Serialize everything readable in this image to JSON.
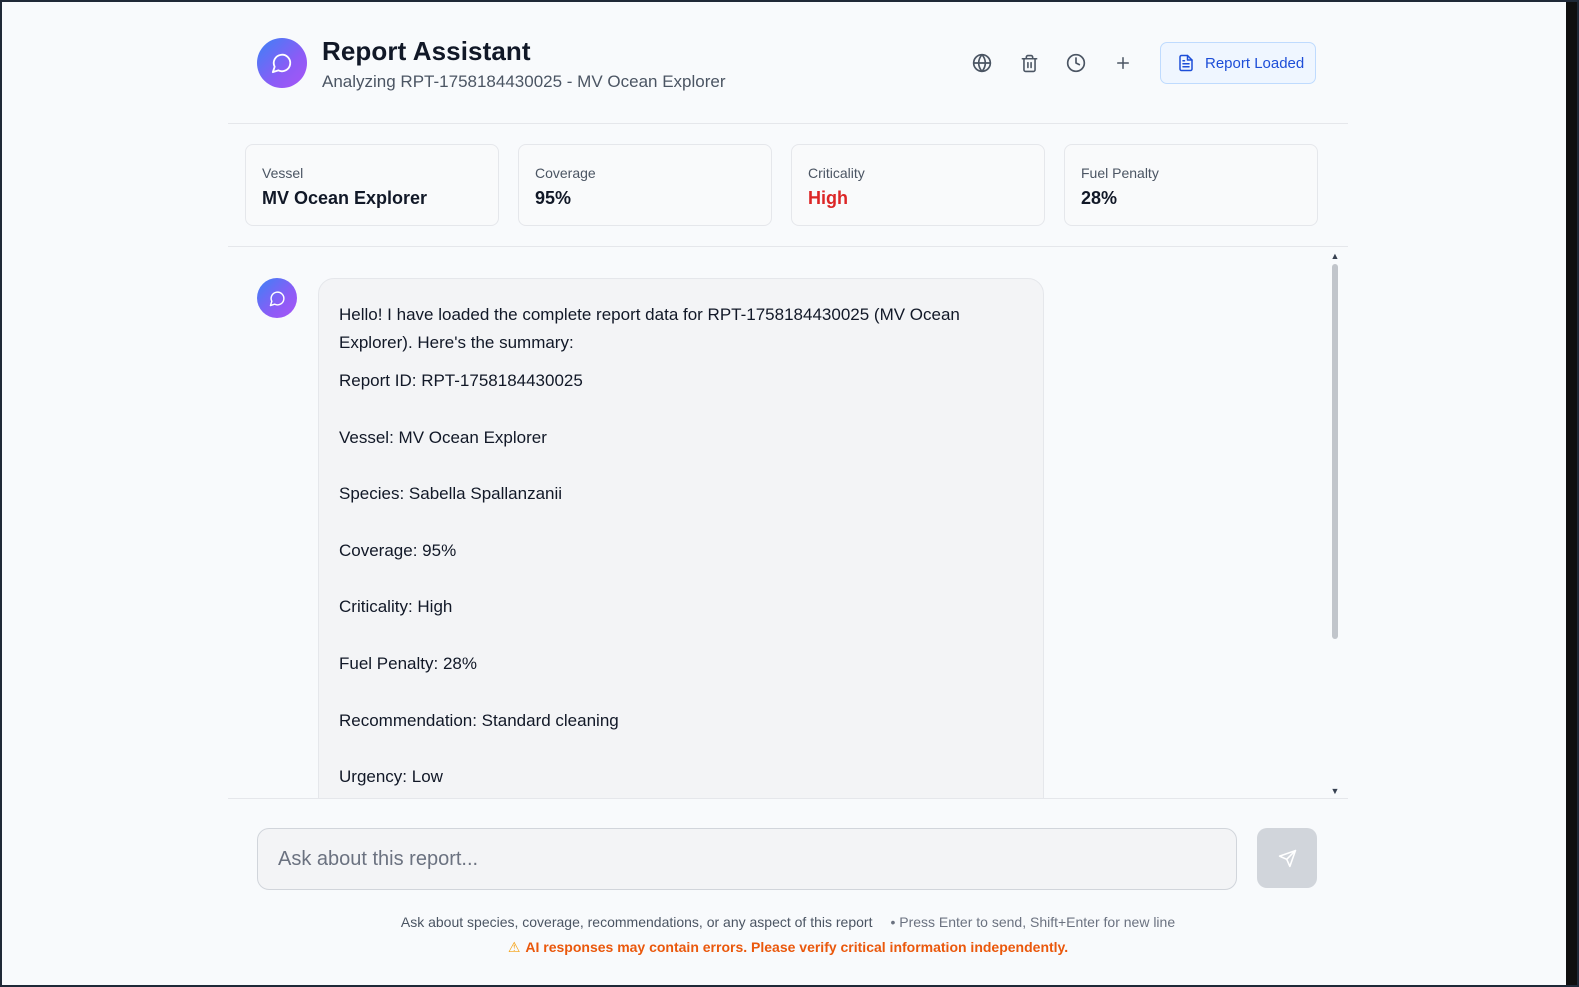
{
  "header": {
    "title": "Report Assistant",
    "subtitle": "Analyzing RPT-1758184430025 - MV Ocean Explorer",
    "actions": [
      "globe-icon",
      "trash-icon",
      "history-icon",
      "plus-icon"
    ],
    "report_button_label": "Report Loaded"
  },
  "stats": [
    {
      "label": "Vessel",
      "value": "MV Ocean Explorer"
    },
    {
      "label": "Coverage",
      "value": "95%"
    },
    {
      "label": "Criticality",
      "value": "High",
      "color": "#dc2626"
    },
    {
      "label": "Fuel Penalty",
      "value": "28%"
    }
  ],
  "message": {
    "intro": "Hello! I have loaded the complete report data for RPT-1758184430025 (MV Ocean Explorer). Here's the summary:",
    "lines": [
      "Report ID: RPT-1758184430025",
      "Vessel: MV Ocean Explorer",
      "Species: Sabella Spallanzanii",
      "Coverage: 95%",
      "Criticality: High",
      "Fuel Penalty: 28%",
      "Recommendation: Standard cleaning",
      "Urgency: Low"
    ]
  },
  "input": {
    "placeholder": "Ask about this report..."
  },
  "footer": {
    "hint": "Ask about species, coverage, recommendations, or any aspect of this report",
    "shortcut": "• Press Enter to send, Shift+Enter for new line",
    "warning": "AI responses may contain errors. Please verify critical information independently."
  },
  "colors": {
    "accent": "#1d4ed8",
    "danger": "#dc2626",
    "warning": "#ea580c",
    "avatar_gradient_start": "#3b82f6",
    "avatar_gradient_end": "#a855f7"
  }
}
